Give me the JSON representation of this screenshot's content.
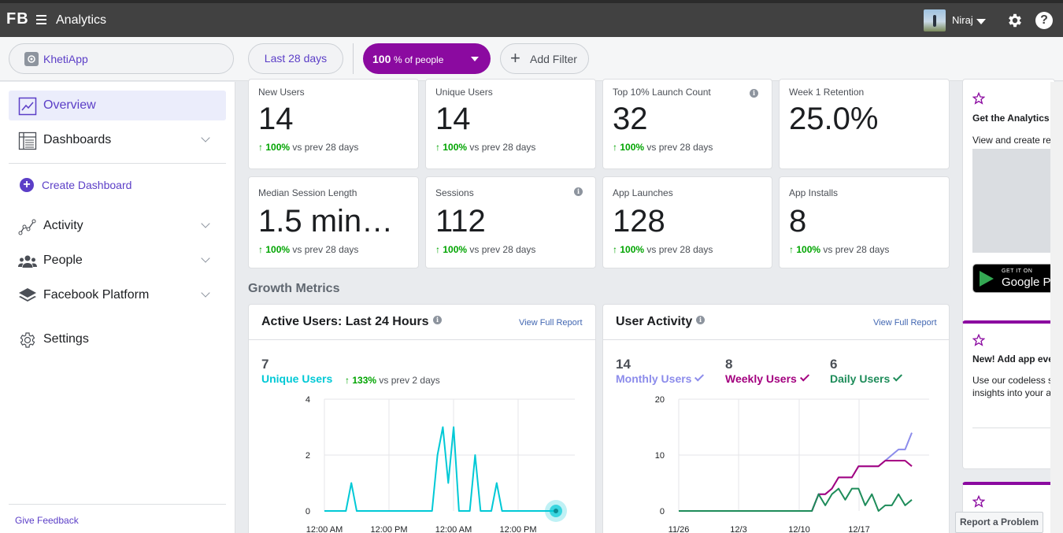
{
  "topbar": {
    "logo": "FB",
    "title": "Analytics",
    "user_name": "Niraj"
  },
  "filters": {
    "app_name": "KhetiApp",
    "date_range": "Last 28 days",
    "people_pct": "100",
    "people_suffix": "% of people",
    "add_filter": "Add Filter"
  },
  "sidebar": {
    "overview": "Overview",
    "dashboards": "Dashboards",
    "create_dashboard": "Create Dashboard",
    "activity": "Activity",
    "people": "People",
    "facebook_platform": "Facebook Platform",
    "settings": "Settings",
    "give_feedback": "Give Feedback"
  },
  "metrics": [
    {
      "label": "New Users",
      "value": "14",
      "change_pct": "100%",
      "change_text": "vs prev 28 days"
    },
    {
      "label": "Unique Users",
      "value": "14",
      "change_pct": "100%",
      "change_text": "vs prev 28 days"
    },
    {
      "label": "Top 10% Launch Count",
      "value": "32",
      "change_pct": "100%",
      "change_text": "vs prev 28 days"
    },
    {
      "label": "Week 1 Retention",
      "value": "25.0%"
    },
    {
      "label": "Median Session Length",
      "value": "1.5 min…",
      "change_pct": "100%",
      "change_text": "vs prev 28 days"
    },
    {
      "label": "Sessions",
      "value": "112",
      "change_pct": "100%",
      "change_text": "vs prev 28 days"
    },
    {
      "label": "App Launches",
      "value": "128",
      "change_pct": "100%",
      "change_text": "vs prev 28 days"
    },
    {
      "label": "App Installs",
      "value": "8",
      "change_pct": "100%",
      "change_text": "vs prev 28 days"
    }
  ],
  "growth_title": "Growth Metrics",
  "active_users": {
    "title": "Active Users: Last 24 Hours",
    "view_full": "View Full Report",
    "count": "7",
    "label": "Unique Users",
    "change_pct": "133%",
    "change_text": "vs prev 2 days"
  },
  "user_activity": {
    "title": "User Activity",
    "view_full": "View Full Report",
    "monthly_count": "14",
    "monthly_label": "Monthly Users",
    "weekly_count": "8",
    "weekly_label": "Weekly Users",
    "daily_count": "6",
    "daily_label": "Daily Users"
  },
  "colors": {
    "accent": "#5b3ec7",
    "teal": "#00c9d6",
    "monthly": "#8c8ceb",
    "weekly": "#a3007f",
    "daily": "#1e8c5a",
    "positive": "#00a400"
  },
  "chart_data": [
    {
      "type": "line",
      "ylim": [
        0,
        4
      ],
      "yticks": [
        "0",
        "2",
        "4"
      ],
      "xticks": [
        "12:00 AM",
        "12:00 PM",
        "12:00 AM",
        "12:00 PM"
      ],
      "series": [
        {
          "values": [
            0,
            0,
            0,
            0,
            0,
            1,
            0,
            0,
            0,
            0,
            0,
            0,
            0,
            0,
            0,
            0,
            0,
            0,
            0,
            0,
            0,
            2,
            3,
            1,
            3,
            0,
            0,
            0,
            2,
            0,
            0,
            0,
            1,
            0,
            0,
            0,
            0,
            0,
            0,
            0,
            0,
            0,
            0,
            0
          ]
        }
      ]
    },
    {
      "type": "line",
      "ylim": [
        0,
        20
      ],
      "yticks": [
        "0",
        "10",
        "20"
      ],
      "xticks": [
        "11/26",
        "12/3",
        "12/10",
        "12/17"
      ],
      "series": [
        {
          "name": "Monthly Users",
          "values": [
            0,
            0,
            0,
            0,
            0,
            0,
            0,
            0,
            0,
            0,
            0,
            0,
            0,
            0,
            0,
            0,
            0,
            0,
            0,
            0,
            0,
            3,
            3,
            4,
            6,
            6,
            6,
            8,
            8,
            8,
            8,
            9,
            10,
            11,
            11,
            14
          ]
        },
        {
          "name": "Weekly Users",
          "values": [
            0,
            0,
            0,
            0,
            0,
            0,
            0,
            0,
            0,
            0,
            0,
            0,
            0,
            0,
            0,
            0,
            0,
            0,
            0,
            0,
            0,
            3,
            3,
            4,
            6,
            6,
            6,
            8,
            8,
            8,
            8,
            9,
            9,
            9,
            9,
            8
          ]
        },
        {
          "name": "Daily Users",
          "values": [
            0,
            0,
            0,
            0,
            0,
            0,
            0,
            0,
            0,
            0,
            0,
            0,
            0,
            0,
            0,
            0,
            0,
            0,
            0,
            0,
            0,
            3,
            1,
            3,
            4,
            2,
            4,
            4,
            1,
            3,
            0,
            1,
            1,
            3,
            1,
            2
          ]
        }
      ]
    }
  ],
  "rail": {
    "card1_title": "Get the Analytics",
    "card1_text": "View and create re",
    "gplay_small": "GET IT ON",
    "gplay_big": "Google P",
    "card2_title": "New! Add app eve",
    "card2_text1": "Use our codeless s",
    "card2_text2": "insights into your a",
    "report_problem": "Report a Problem"
  }
}
